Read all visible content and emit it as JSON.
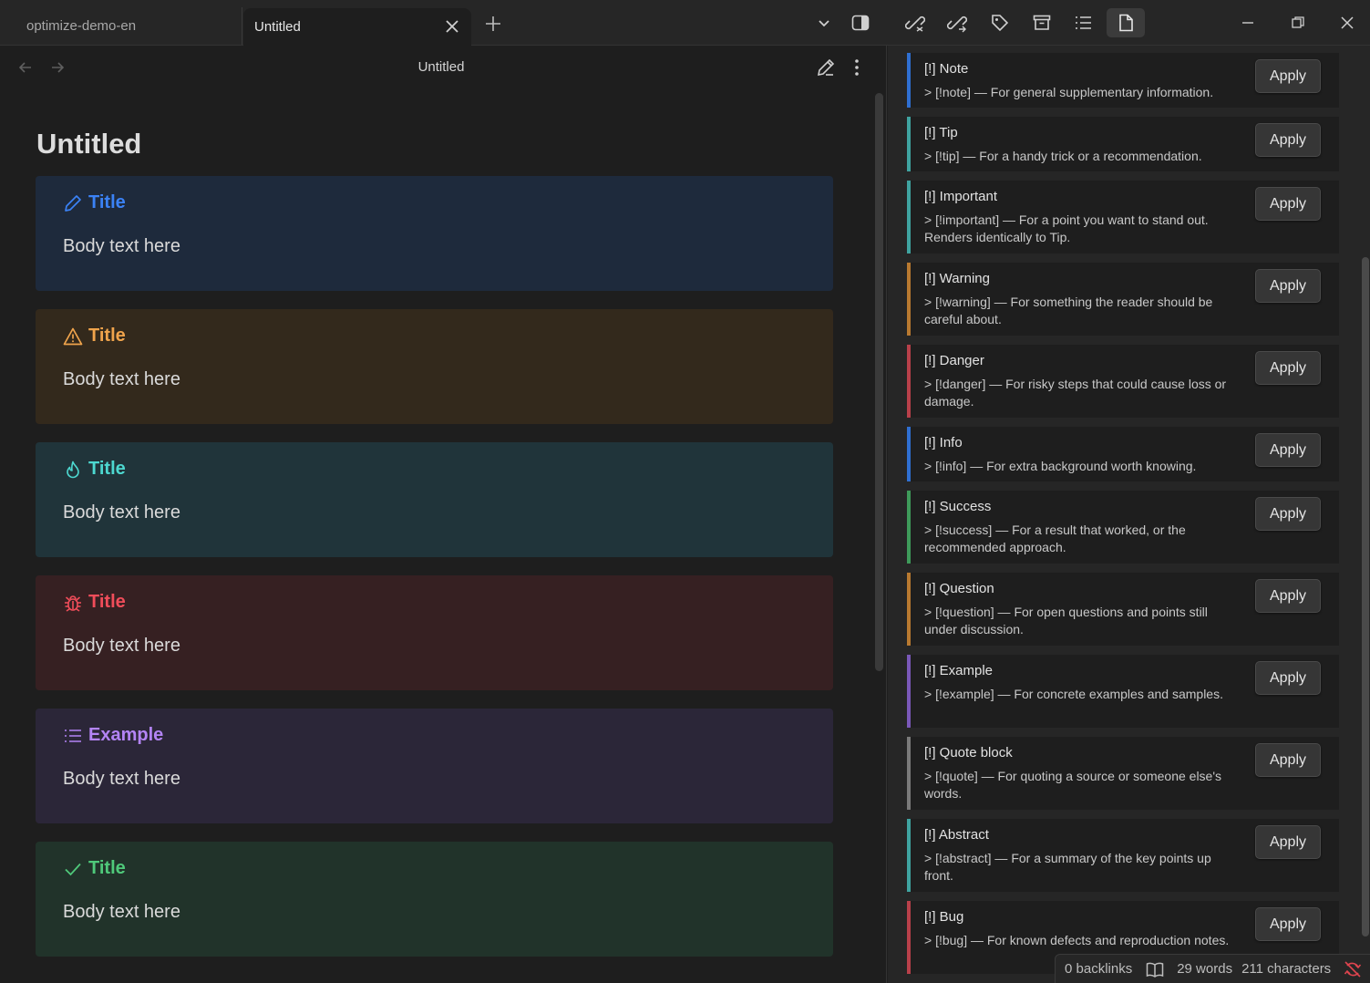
{
  "tabs": {
    "inactive_label": "optimize-demo-en",
    "active_label": "Untitled"
  },
  "editor": {
    "view_title": "Untitled",
    "note_title": "Untitled",
    "callouts": [
      {
        "title": "Title",
        "body": "Body text here",
        "icon": "pencil-icon",
        "accent": "#3b82f6",
        "bg": "#1e2a3c"
      },
      {
        "title": "Title",
        "body": "Body text here",
        "icon": "warning-icon",
        "accent": "#f0a44c",
        "bg": "#33291c"
      },
      {
        "title": "Title",
        "body": "Body text here",
        "icon": "flame-icon",
        "accent": "#4dd8d0",
        "bg": "#20343a"
      },
      {
        "title": "Title",
        "body": "Body text here",
        "icon": "bug-icon",
        "accent": "#f04d5a",
        "bg": "#362022"
      },
      {
        "title": "Example",
        "body": "Body text here",
        "icon": "list-icon",
        "accent": "#b384f5",
        "bg": "#2b2638"
      },
      {
        "title": "Title",
        "body": "Body text here",
        "icon": "check-icon",
        "accent": "#4fc97a",
        "bg": "#21332a"
      }
    ]
  },
  "panel": {
    "apply_label": "Apply",
    "items": [
      {
        "name": "[!] Note",
        "desc": "> [!note] — For general supplementary information.",
        "color": "#2f6fd1"
      },
      {
        "name": "[!] Tip",
        "desc": "> [!tip] — For a handy trick or a recommendation.",
        "color": "#3fa3a0"
      },
      {
        "name": "[!] Important",
        "desc": "> [!important] — For a point you want to stand out. Renders identically to Tip.",
        "color": "#3fa3a0"
      },
      {
        "name": "[!] Warning",
        "desc": "> [!warning] — For something the reader should be careful about.",
        "color": "#b87930"
      },
      {
        "name": "[!] Danger",
        "desc": "> [!danger] — For risky steps that could cause loss or damage.",
        "color": "#b8404a"
      },
      {
        "name": "[!] Info",
        "desc": "> [!info] — For extra background worth knowing.",
        "color": "#2f6fd1"
      },
      {
        "name": "[!] Success",
        "desc": "> [!success] — For a result that worked, or the recommended approach.",
        "color": "#3e9a5a"
      },
      {
        "name": "[!] Question",
        "desc": "> [!question] — For open questions and points still under discussion.",
        "color": "#b87930"
      },
      {
        "name": "[!] Example",
        "desc": "> [!example] — For concrete examples and samples.",
        "color": "#7a58b8"
      },
      {
        "name": "[!] Quote block",
        "desc": "> [!quote] — For quoting a source or someone else's words.",
        "color": "#7a7a7a"
      },
      {
        "name": "[!] Abstract",
        "desc": "> [!abstract] — For a summary of the key points up front.",
        "color": "#3fa3a0"
      },
      {
        "name": "[!] Bug",
        "desc": "> [!bug] — For known defects and reproduction notes.",
        "color": "#b8404a"
      }
    ]
  },
  "status": {
    "backlinks": "0 backlinks",
    "words": "29 words",
    "characters": "211 characters"
  }
}
